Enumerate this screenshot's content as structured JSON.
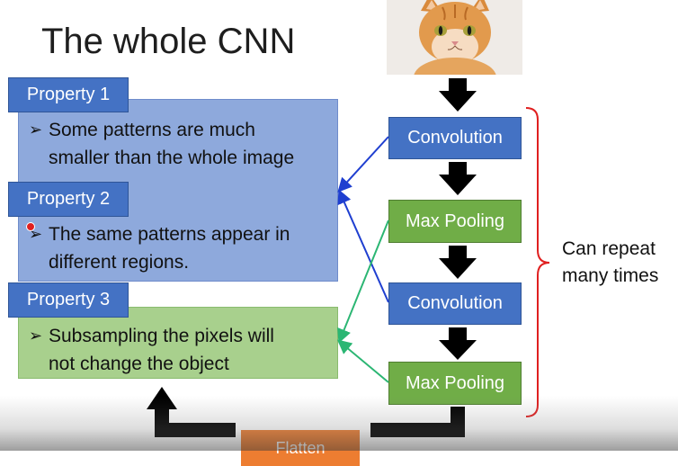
{
  "slide": {
    "title": "The whole CNN",
    "properties": [
      {
        "tab": "Property 1",
        "text_line1": "Some patterns are much",
        "text_line2": "smaller than the whole image"
      },
      {
        "tab": "Property 2",
        "text_line1": "The same patterns appear in",
        "text_line2": "different regions."
      },
      {
        "tab": "Property 3",
        "text_line1": "Subsampling the pixels will",
        "text_line2": "not change the object"
      }
    ],
    "pipeline": [
      {
        "label": "Convolution",
        "kind": "conv"
      },
      {
        "label": "Max Pooling",
        "kind": "pool"
      },
      {
        "label": "Convolution",
        "kind": "conv"
      },
      {
        "label": "Max Pooling",
        "kind": "pool"
      }
    ],
    "repeat_label_line1": "Can repeat",
    "repeat_label_line2": "many times",
    "flatten_label": "Flatten",
    "input_image": "kitten-photo",
    "colors": {
      "blue_box": "#8ea9dc",
      "green_box": "#a8d08d",
      "tab_blue": "#4472c4",
      "conv_blue": "#4472c4",
      "pool_green": "#70ad47",
      "brace_red": "#e02020",
      "arrow_black": "#000000",
      "connector_blue": "#1f3fd0",
      "connector_green": "#2bb673",
      "flatten_orange": "#ed7d31"
    }
  }
}
